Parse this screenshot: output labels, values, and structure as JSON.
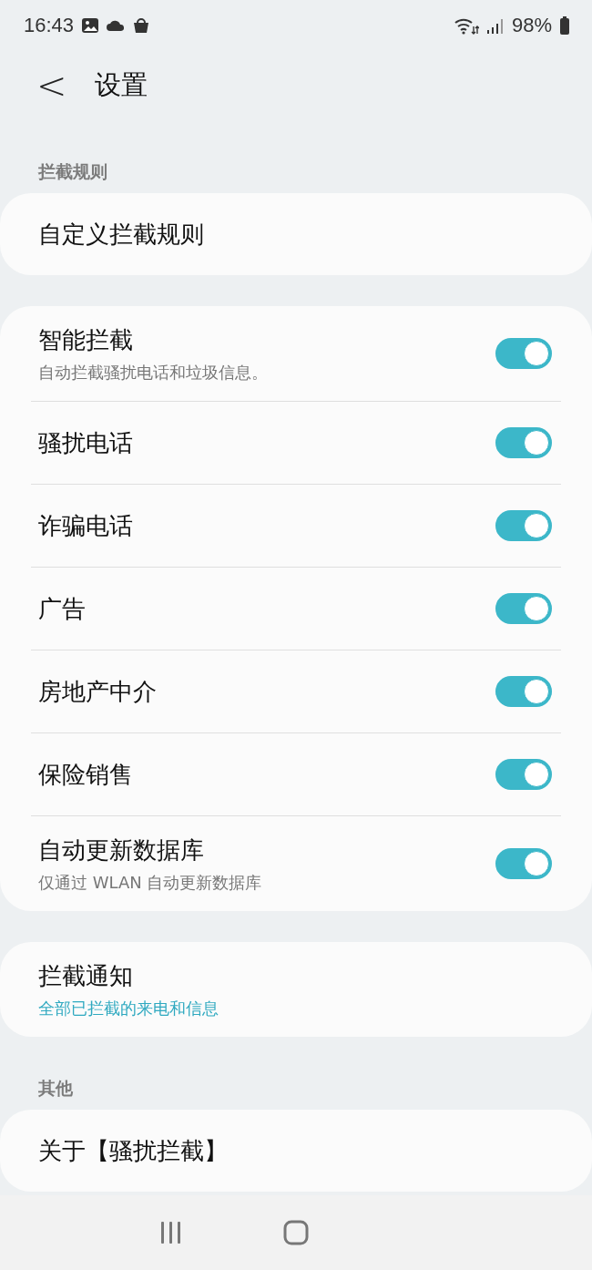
{
  "status_bar": {
    "time": "16:43",
    "battery": "98%"
  },
  "header": {
    "back": "<",
    "title": "设置"
  },
  "sections": [
    {
      "label": "拦截规则",
      "items": [
        {
          "title": "自定义拦截规则",
          "kind": "link"
        }
      ]
    },
    {
      "items": [
        {
          "title": "智能拦截",
          "subtitle": "自动拦截骚扰电话和垃圾信息。",
          "kind": "toggle",
          "on": true
        },
        {
          "title": "骚扰电话",
          "kind": "toggle",
          "on": true
        },
        {
          "title": "诈骗电话",
          "kind": "toggle",
          "on": true
        },
        {
          "title": "广告",
          "kind": "toggle",
          "on": true
        },
        {
          "title": "房地产中介",
          "kind": "toggle",
          "on": true
        },
        {
          "title": "保险销售",
          "kind": "toggle",
          "on": true
        },
        {
          "title": "自动更新数据库",
          "subtitle": "仅通过 WLAN 自动更新数据库",
          "kind": "toggle",
          "on": true
        }
      ]
    },
    {
      "items": [
        {
          "title": "拦截通知",
          "link": "全部已拦截的来电和信息",
          "kind": "link"
        }
      ]
    },
    {
      "label": "其他",
      "items": [
        {
          "title": "关于【骚扰拦截】",
          "kind": "link"
        }
      ]
    }
  ]
}
